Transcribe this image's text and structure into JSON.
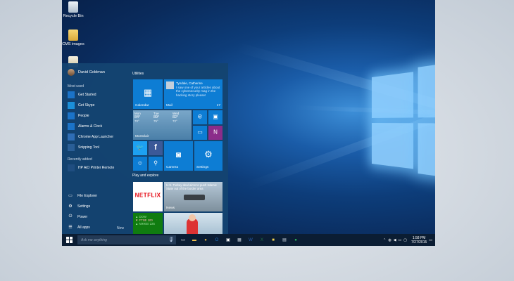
{
  "desktop": {
    "icons": [
      {
        "label": "Recycle Bin",
        "icon": "recycle-bin-icon"
      },
      {
        "label": "CMS images",
        "icon": "folder-icon"
      },
      {
        "label": "",
        "icon": "document-icon"
      }
    ]
  },
  "start_menu": {
    "user_name": "David Goldman",
    "most_used_label": "Most used",
    "most_used": [
      {
        "label": "Get Started",
        "icon": "lightbulb-icon",
        "color": "#1b73c8"
      },
      {
        "label": "Get Skype",
        "icon": "skype-icon",
        "color": "#1b8fd8"
      },
      {
        "label": "People",
        "icon": "people-icon",
        "color": "#1b73c8"
      },
      {
        "label": "Alarms & Clock",
        "icon": "clock-icon",
        "color": "#1b73c8"
      },
      {
        "label": "Chrome App Launcher",
        "icon": "chrome-icon",
        "color": "#2f6db5"
      },
      {
        "label": "Snipping Tool",
        "icon": "scissors-icon",
        "color": "#2a5e96"
      }
    ],
    "recently_added_label": "Recently added",
    "recently_added": [
      {
        "label": "HP AiO Printer Remote",
        "icon": "printer-icon",
        "color": "#1f4d80"
      }
    ],
    "bottom_items": [
      {
        "label": "File Explorer",
        "icon": "folder-icon",
        "glyph": "▭"
      },
      {
        "label": "Settings",
        "icon": "gear-icon",
        "glyph": "⚙"
      },
      {
        "label": "Power",
        "icon": "power-icon",
        "glyph": "⏻"
      },
      {
        "label": "All apps",
        "icon": "all-apps-icon",
        "glyph": "☰"
      }
    ],
    "new_label": "New",
    "groups": {
      "utilities": "Utilities",
      "play_explore": "Play and explore"
    },
    "tiles": {
      "calendar": "Calendar",
      "mail": "Mail",
      "mail_count": "17",
      "mail_sender": "Tyndale, Catherine",
      "mail_preview": "I saw one of your articles about the cybersecurity mag in the hacking story please!",
      "weather": {
        "days": [
          {
            "day": "Mon",
            "temp": "84°",
            "low": "70°"
          },
          {
            "day": "Tue",
            "temp": "89°",
            "low": "75°"
          },
          {
            "day": "Wed",
            "temp": "82°",
            "low": "72°"
          }
        ],
        "location": "Montclair"
      },
      "camera": "Camera",
      "settings": "Settings",
      "netflix": "NETFLIX",
      "news_headline": "U.S. Turkey deal aims to push Islamic State out of the border area",
      "news": "News",
      "stocks": [
        {
          "name": "▲ DOW",
          "color": "#9fe39f"
        },
        {
          "name": "▼ FTSE 100",
          "color": "#ffb3b3"
        },
        {
          "name": "▲ NIKKEI 225",
          "color": "#9fe39f"
        }
      ]
    }
  },
  "taskbar": {
    "search_placeholder": "Ask me anything",
    "apps": [
      {
        "icon": "task-view-icon",
        "glyph": "▭",
        "color": "#ffffff"
      },
      {
        "icon": "file-explorer-icon",
        "glyph": "▬",
        "color": "#f2c14e"
      },
      {
        "icon": "chrome-icon",
        "glyph": "●",
        "color": "#e2b33a"
      },
      {
        "icon": "outlook-icon",
        "glyph": "O",
        "color": "#1f6fc0"
      },
      {
        "icon": "store-icon",
        "glyph": "▣",
        "color": "#ffffff"
      },
      {
        "icon": "photos-icon",
        "glyph": "▦",
        "color": "#cfd8e3"
      },
      {
        "icon": "word-icon",
        "glyph": "W",
        "color": "#2b5fb0"
      },
      {
        "icon": "excel-icon",
        "glyph": "X",
        "color": "#217346"
      },
      {
        "icon": "sticky-notes-icon",
        "glyph": "■",
        "color": "#f2d24e"
      },
      {
        "icon": "calculator-icon",
        "glyph": "▤",
        "color": "#cfd8e3"
      },
      {
        "icon": "evernote-icon",
        "glyph": "●",
        "color": "#2dbe60"
      }
    ],
    "time": "1:58 PM",
    "date": "7/27/2015"
  }
}
